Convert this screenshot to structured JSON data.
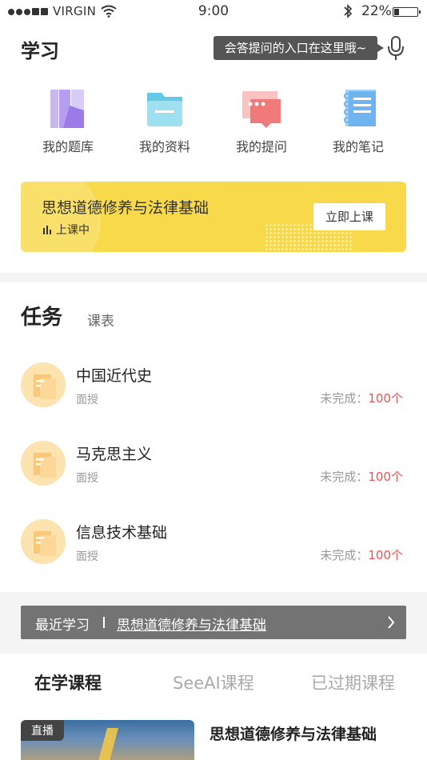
{
  "status_bar": {
    "carrier": "VIRGIN",
    "time": "9:00",
    "battery_text": "22%",
    "battery_level": 0.22
  },
  "header": {
    "title": "学习",
    "tooltip": "会答提问的入口在这里哦~",
    "mic_icon": "microphone-icon"
  },
  "entries": [
    {
      "label": "我的题库",
      "icon": "question-bank-icon",
      "color": "#9b7be8"
    },
    {
      "label": "我的资料",
      "icon": "folder-icon",
      "color": "#63c9e6"
    },
    {
      "label": "我的提问",
      "icon": "chat-bubble-icon",
      "color": "#f07a7a"
    },
    {
      "label": "我的笔记",
      "icon": "notebook-icon",
      "color": "#6fb4ee"
    }
  ],
  "banner": {
    "title": "思想道德修养与法律基础",
    "status": "上课中",
    "button": "立即上课",
    "color": "#f8d94a"
  },
  "tasks_section": {
    "active_tab": "任务",
    "other_tab": "课表",
    "status_label": "未完成：",
    "items": [
      {
        "name": "中国近代史",
        "type": "面授",
        "count": "100个"
      },
      {
        "name": "马克思主义",
        "type": "面授",
        "count": "100个"
      },
      {
        "name": "信息技术基础",
        "type": "面授",
        "count": "100个"
      }
    ]
  },
  "recent": {
    "label": "最近学习",
    "course": "思想道德修养与法律基础"
  },
  "course_tabs": [
    "在学课程",
    "SeeAI课程",
    "已过期课程"
  ],
  "course_card": {
    "tag": "直播",
    "title": "思想道德修养与法律基础"
  }
}
